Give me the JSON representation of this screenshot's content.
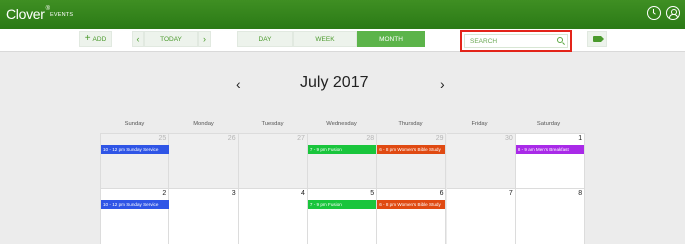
{
  "brand": {
    "name": "Clover",
    "mark": "®",
    "sub": "EVENTS"
  },
  "header_icons": [
    "clock-icon",
    "user-icon"
  ],
  "toolbar": {
    "add_label": "ADD",
    "today_label": "TODAY",
    "prev_glyph": "‹",
    "next_glyph": "›",
    "views": [
      "DAY",
      "WEEK",
      "MONTH"
    ],
    "active_view": "MONTH",
    "search_placeholder": "SEARCH"
  },
  "calendar": {
    "title": "July 2017",
    "prev_glyph": "‹",
    "next_glyph": "›",
    "weekdays": [
      "Sunday",
      "Monday",
      "Tuesday",
      "Wednesday",
      "Thursday",
      "Friday",
      "Saturday"
    ],
    "weeks": [
      [
        {
          "day": "25",
          "out": true,
          "events": [
            {
              "title": "10 - 12 pm Sunday Service",
              "color": "#2f55e6"
            }
          ]
        },
        {
          "day": "26",
          "out": true,
          "events": []
        },
        {
          "day": "27",
          "out": true,
          "events": []
        },
        {
          "day": "28",
          "out": true,
          "events": [
            {
              "title": "7 - 9 pm Fusion",
              "color": "#19c53c"
            }
          ]
        },
        {
          "day": "29",
          "out": true,
          "events": [
            {
              "title": "6 - 8 pm Women's Bible Study",
              "color": "#e04a12"
            }
          ]
        },
        {
          "day": "30",
          "out": true,
          "events": []
        },
        {
          "day": "1",
          "out": false,
          "events": [
            {
              "title": "8 - 9 am Men's Breakfast",
              "color": "#a92ae8"
            }
          ]
        }
      ],
      [
        {
          "day": "2",
          "out": false,
          "events": [
            {
              "title": "10 - 12 pm Sunday Service",
              "color": "#2f55e6"
            }
          ]
        },
        {
          "day": "3",
          "out": false,
          "events": []
        },
        {
          "day": "4",
          "out": false,
          "events": []
        },
        {
          "day": "5",
          "out": false,
          "events": [
            {
              "title": "7 - 9 pm Fusion",
              "color": "#19c53c"
            }
          ]
        },
        {
          "day": "6",
          "out": false,
          "events": [
            {
              "title": "6 - 8 pm Women's Bible Study",
              "color": "#e04a12"
            }
          ]
        },
        {
          "day": "7",
          "out": false,
          "events": []
        },
        {
          "day": "8",
          "out": false,
          "events": []
        }
      ]
    ]
  },
  "colors": {
    "brand_green": "#2f7f19",
    "accent_green": "#5cb44a",
    "highlight_red": "#e3241a"
  }
}
